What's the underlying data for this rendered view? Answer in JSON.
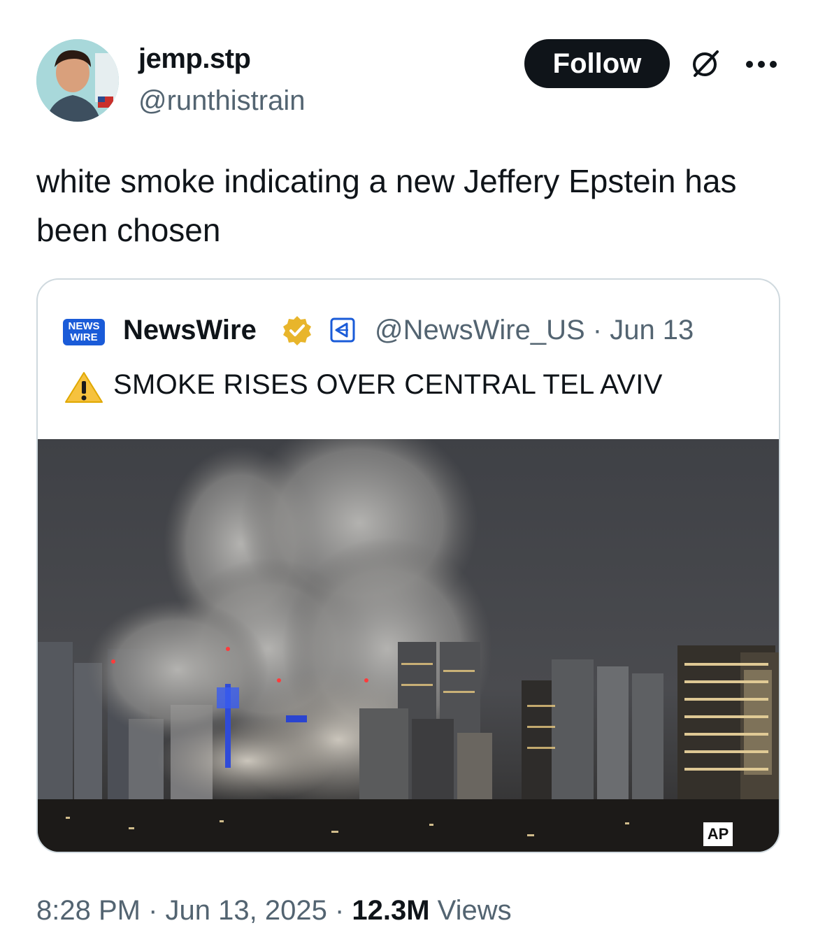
{
  "tweet": {
    "display_name": "jemp.stp",
    "handle": "@runthistrain",
    "follow_label": "Follow",
    "text": "white smoke indicating a new Jeffery Epstein has been chosen",
    "time": "8:28 PM",
    "sep1": " · ",
    "date": "Jun 13, 2025",
    "sep2": " · ",
    "views_count": "12.3M",
    "views_label": " Views"
  },
  "quote": {
    "logo_line1": "NEWS",
    "logo_line2": "WIRE",
    "name": "NewsWire",
    "handle_date": "@NewsWire_US · Jun 13",
    "text": "SMOKE RISES OVER CENTRAL TEL AVIV",
    "image_credit": "AP"
  },
  "icons": {
    "verified": "verified-badge-icon",
    "affiliate": "affiliate-icon",
    "warning": "warning-icon",
    "grok": "grok-icon",
    "more": "more-icon"
  },
  "colors": {
    "text_primary": "#0f1419",
    "text_secondary": "#536471",
    "border": "#cfd9de",
    "verified_gold": "#e8b52b",
    "logo_blue": "#1a5bd8"
  }
}
